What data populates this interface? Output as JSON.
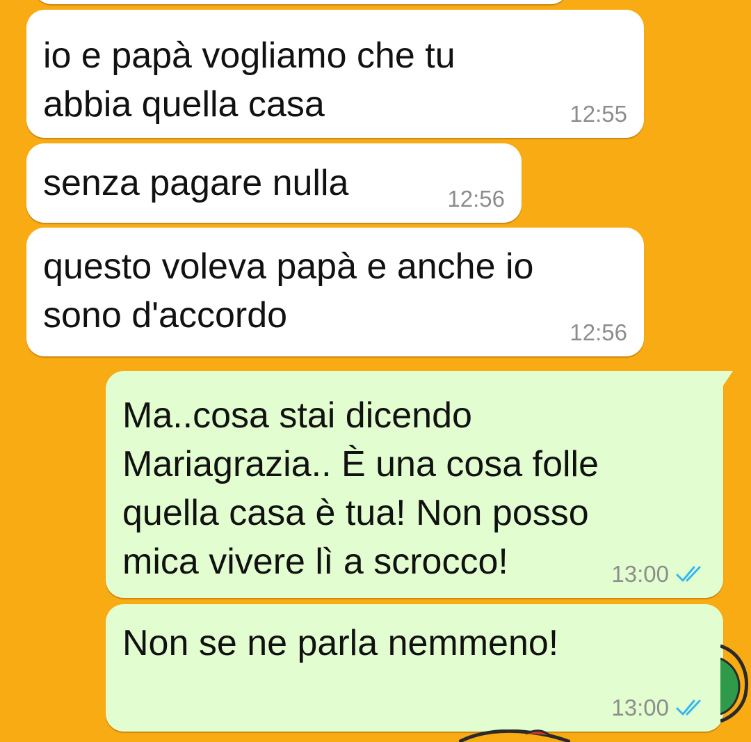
{
  "chat": {
    "background_color": "#f9ab14",
    "incoming_bubble_color": "#ffffff",
    "outgoing_bubble_color": "#e2fdcf",
    "read_receipt_color": "#34b7f1",
    "messages": [
      {
        "direction": "incoming",
        "lines": [
          "io e papà vogliamo che tu",
          "abbia quella casa"
        ],
        "time": "12:55"
      },
      {
        "direction": "incoming",
        "lines": [
          "senza pagare nulla"
        ],
        "time": "12:56"
      },
      {
        "direction": "incoming",
        "lines": [
          "questo voleva papà e anche io",
          "sono d'accordo"
        ],
        "time": "12:56"
      },
      {
        "direction": "outgoing",
        "lines": [
          "Ma..cosa stai dicendo",
          "Mariagrazia.. È una cosa folle",
          "quella casa è tua! Non posso",
          "mica vivere lì a scrocco!"
        ],
        "time": "13:00",
        "status_icon": "double-check-read-icon"
      },
      {
        "direction": "outgoing",
        "lines": [
          "Non se ne parla nemmeno!"
        ],
        "time": "13:00",
        "status_icon": "double-check-read-icon"
      }
    ]
  }
}
